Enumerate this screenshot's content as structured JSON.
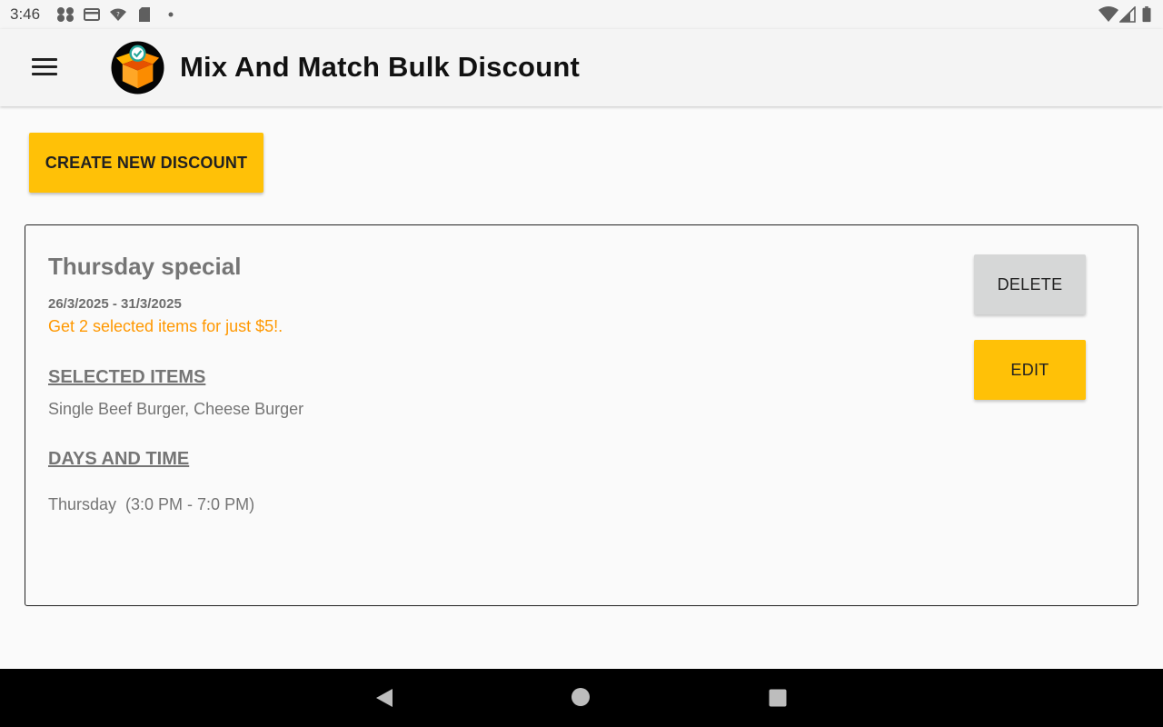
{
  "status_bar": {
    "time": "3:46",
    "left_icons": [
      "fan-icon",
      "card-icon",
      "wifi-question-icon",
      "sd-card-icon",
      "dot-icon"
    ],
    "right_icons": [
      "wifi-icon",
      "signal-icon",
      "battery-icon"
    ]
  },
  "app_bar": {
    "title": "Mix And Match Bulk Discount",
    "menu_icon": "hamburger-menu-icon",
    "logo_icon": "open-box-logo-icon"
  },
  "actions": {
    "create_label": "CREATE NEW DISCOUNT"
  },
  "discount": {
    "name": "Thursday special",
    "dates": "26/3/2025 - 31/3/2025",
    "description": "Get 2 selected items for just $5!.",
    "selected_items_heading": "SELECTED ITEMS",
    "selected_items": "Single Beef Burger, Cheese Burger",
    "days_time_heading": "DAYS AND TIME",
    "days_time": "Thursday  (3:0 PM - 7:0 PM)",
    "delete_label": "DELETE",
    "edit_label": "EDIT"
  },
  "nav_bar": {
    "icons": [
      "back-icon",
      "home-icon",
      "recents-icon"
    ]
  },
  "colors": {
    "accent": "#ffc107",
    "description_orange": "#ff9800",
    "delete_gray": "#d6d7d7",
    "text_gray": "#757575"
  }
}
